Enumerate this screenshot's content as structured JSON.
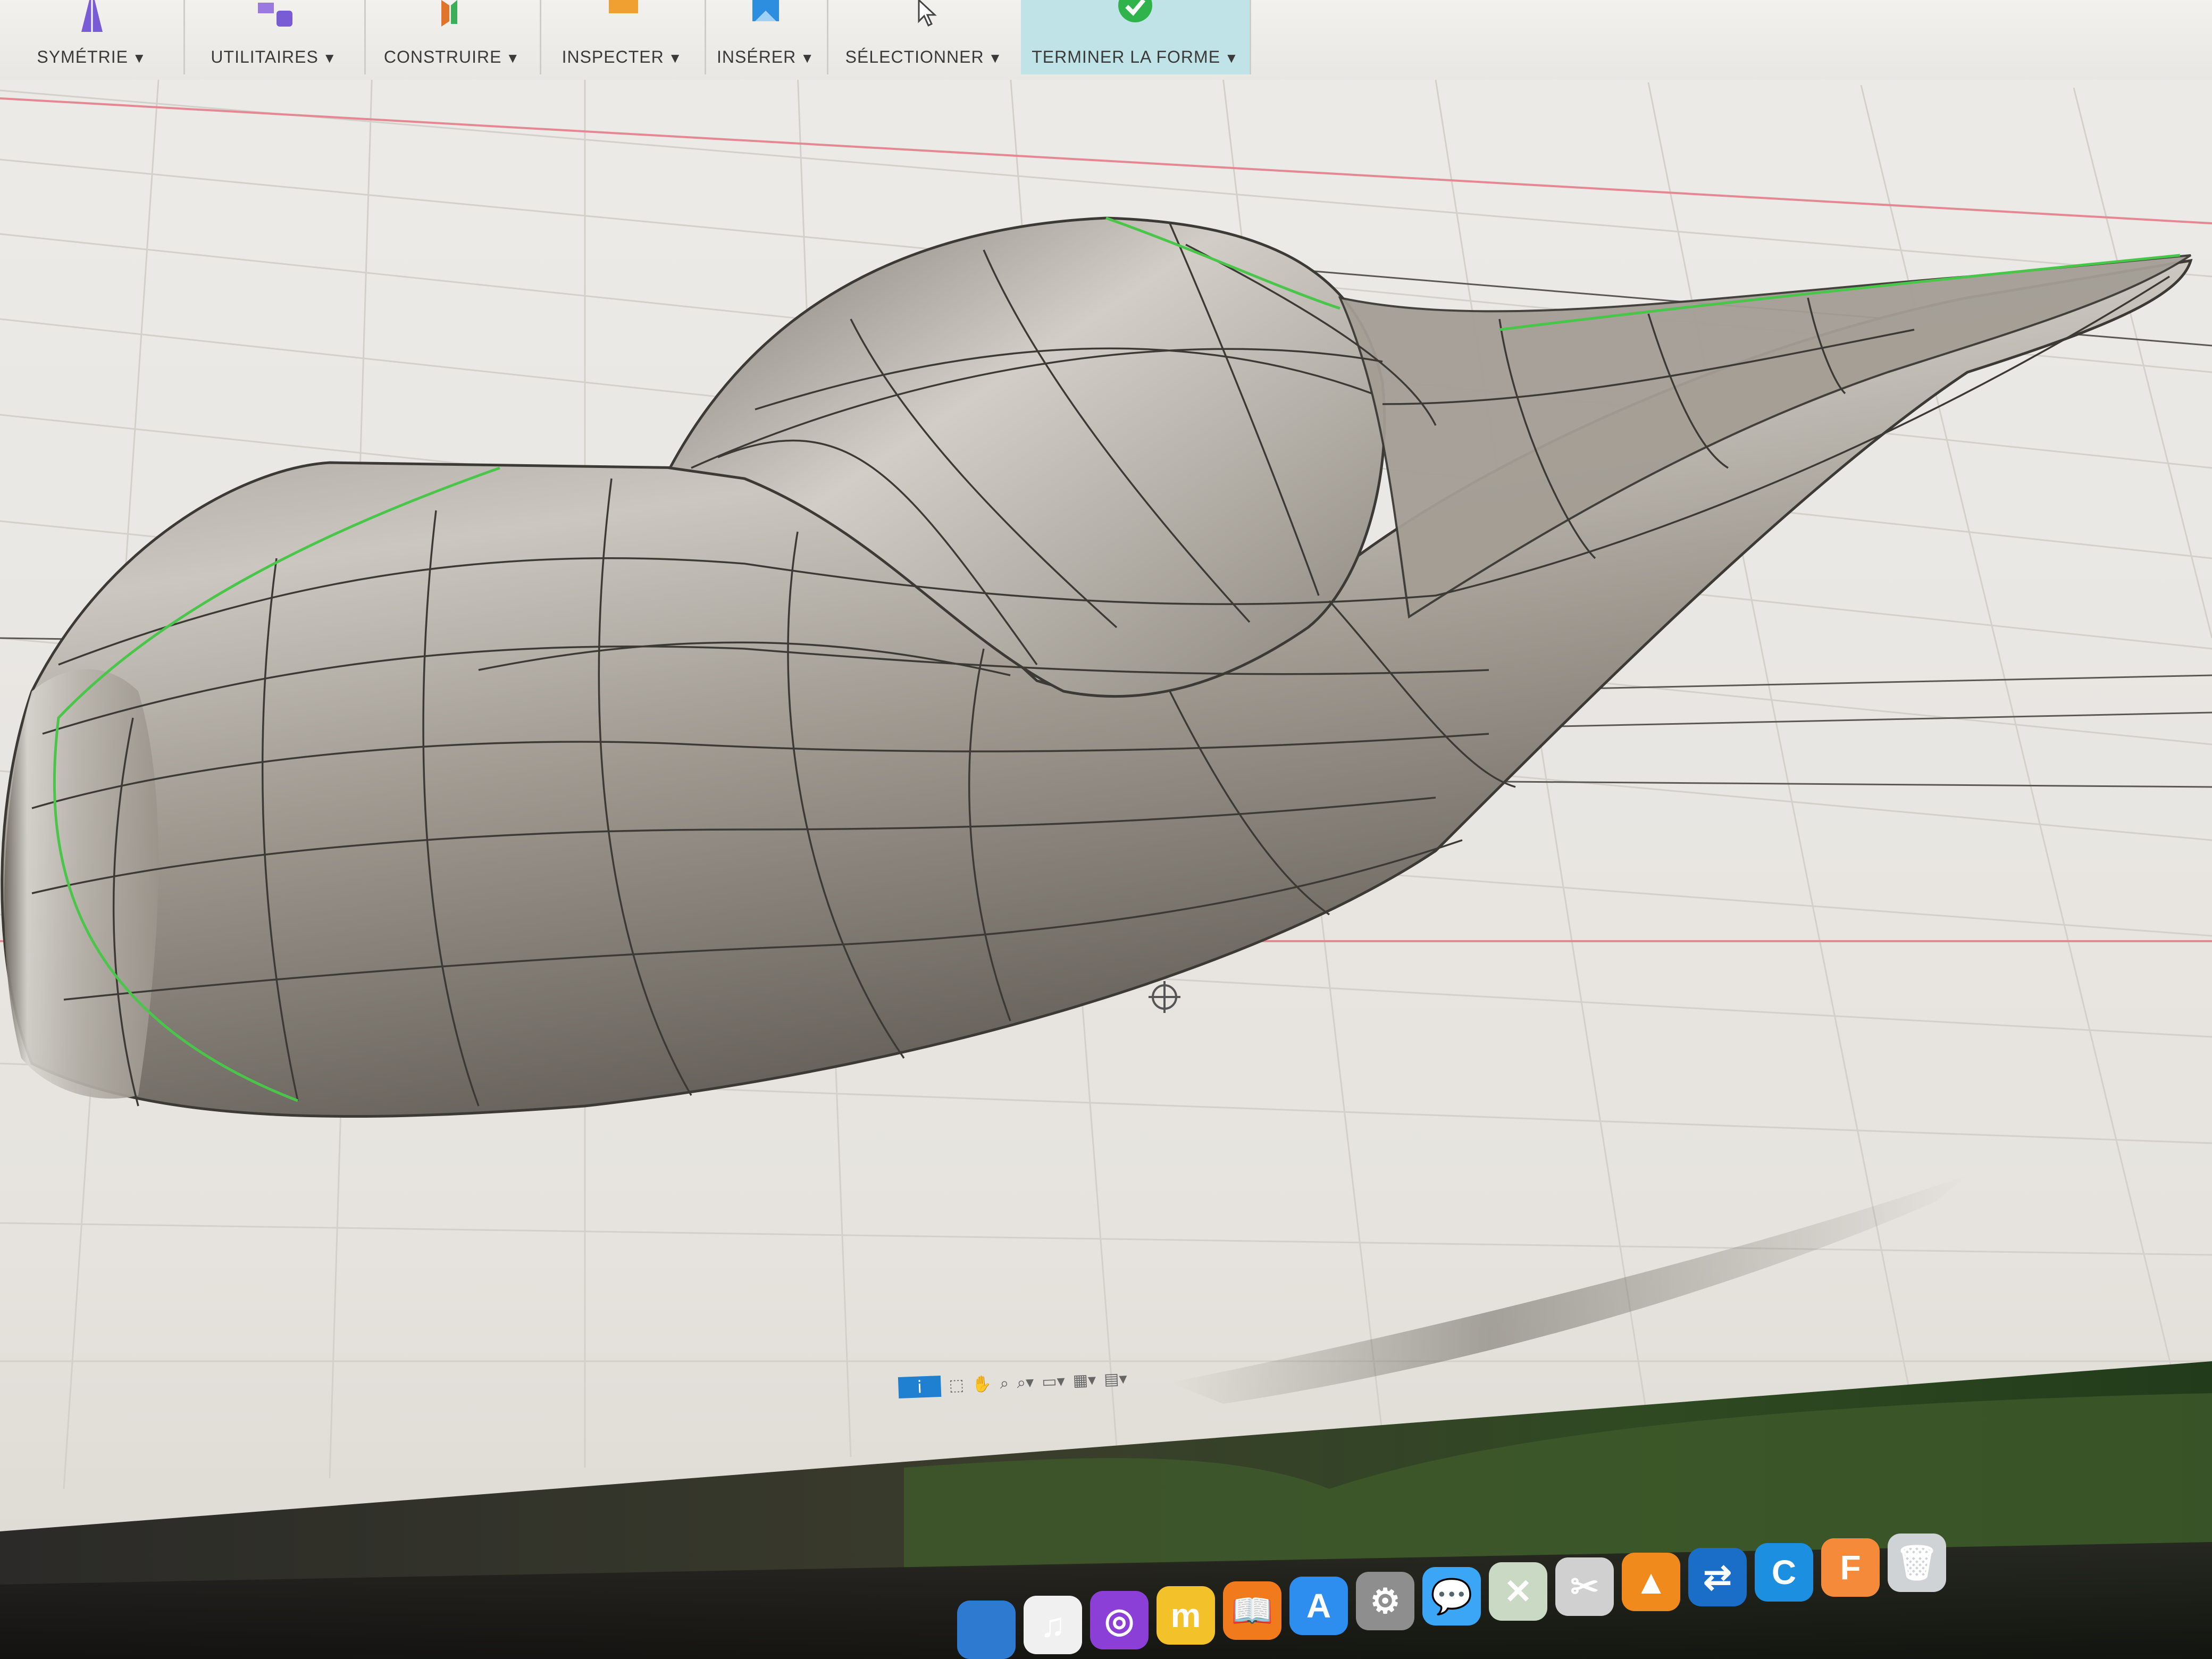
{
  "toolbar": {
    "groups": [
      {
        "label": "SYMÉTRIE",
        "icon": "symmetry-icon"
      },
      {
        "label": "UTILITAIRES",
        "icon": "utilities-icon"
      },
      {
        "label": "CONSTRUIRE",
        "icon": "construct-icon"
      },
      {
        "label": "INSPECTER",
        "icon": "inspect-icon"
      },
      {
        "label": "INSÉRER",
        "icon": "insert-icon"
      },
      {
        "label": "SÉLECTIONNER",
        "icon": "select-icon"
      },
      {
        "label": "TERMINER LA FORME",
        "icon": "finish-form-icon"
      }
    ],
    "caret": "▼",
    "active_color": "#bfe3e6",
    "finish_icon_color": "#2fb34a"
  },
  "navbar": {
    "items": [
      "info-button",
      "orbit-icon",
      "pan-icon",
      "zoom-icon",
      "fit-icon",
      "display-settings-icon",
      "grid-settings-icon",
      "viewports-icon"
    ],
    "info_label": "i"
  },
  "viewport": {
    "background": "#e9e6e1",
    "grid_color": "#cfccc6",
    "axis_x_color": "#e07a86",
    "model_edge_color": "#3d3a36",
    "selected_edge_color": "#49c64a"
  },
  "dock": {
    "apps": [
      {
        "name": "finder-app",
        "color": "#2e7ad1",
        "glyph": ""
      },
      {
        "name": "music-app",
        "color": "#f0f0f0",
        "glyph": "♫"
      },
      {
        "name": "podcasts-app",
        "color": "#8c3fd6",
        "glyph": "◎"
      },
      {
        "name": "miro-app",
        "color": "#f3c12a",
        "glyph": "m"
      },
      {
        "name": "books-app",
        "color": "#f07a1c",
        "glyph": "📖"
      },
      {
        "name": "app-store-app",
        "color": "#2d8ef0",
        "glyph": "A"
      },
      {
        "name": "system-prefs-app",
        "color": "#8e8e8e",
        "glyph": "⚙"
      },
      {
        "name": "messages-app",
        "color": "#3aa6f5",
        "glyph": "💬"
      },
      {
        "name": "utility-app",
        "color": "#c9d9c4",
        "glyph": "✕"
      },
      {
        "name": "tools-app",
        "color": "#d0d0d0",
        "glyph": "✂"
      },
      {
        "name": "vlc-app",
        "color": "#f08a1c",
        "glyph": "▲"
      },
      {
        "name": "teamviewer-app",
        "color": "#1a6ec7",
        "glyph": "⇄"
      },
      {
        "name": "c-app",
        "color": "#1d8fe0",
        "glyph": "C"
      },
      {
        "name": "fusion-app",
        "color": "#f58a3a",
        "glyph": "F"
      },
      {
        "name": "trash-app",
        "color": "#cfd3d6",
        "glyph": "🗑"
      }
    ]
  }
}
